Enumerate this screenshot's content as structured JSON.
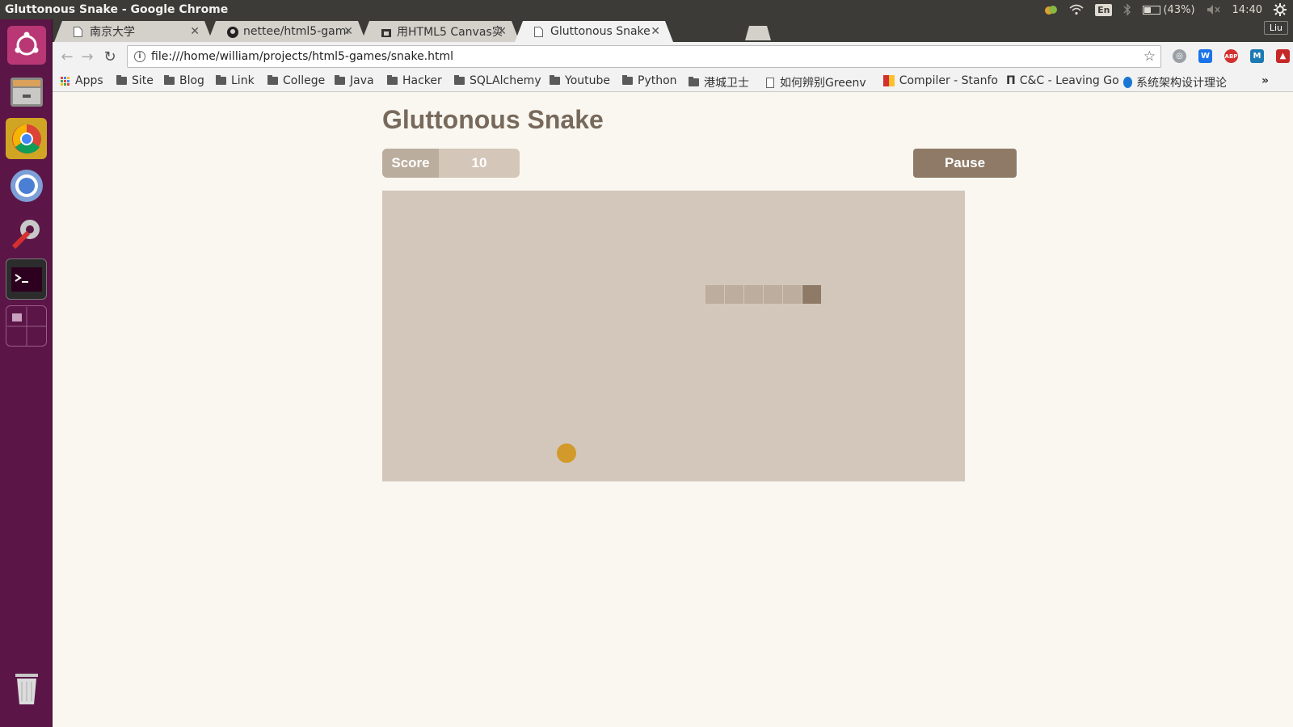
{
  "system": {
    "window_title": "Gluttonous Snake - Google Chrome",
    "battery": "(43%)",
    "time": "14:40",
    "input_method": "En",
    "user": "Liu"
  },
  "browser": {
    "tabs": [
      {
        "title": "南京大学",
        "active": false
      },
      {
        "title": "nettee/html5-game",
        "active": false
      },
      {
        "title": "用HTML5 Canvas实",
        "active": false
      },
      {
        "title": "Gluttonous Snake",
        "active": true
      }
    ],
    "url": "file:///home/william/projects/html5-games/snake.html",
    "bookmarks": [
      {
        "label": "Apps",
        "icon": "apps-grid-icon"
      },
      {
        "label": "Site",
        "icon": "folder-icon"
      },
      {
        "label": "Blog",
        "icon": "folder-icon"
      },
      {
        "label": "Link",
        "icon": "folder-icon"
      },
      {
        "label": "College",
        "icon": "folder-icon"
      },
      {
        "label": "Java",
        "icon": "folder-icon"
      },
      {
        "label": "Hacker",
        "icon": "folder-icon"
      },
      {
        "label": "SQLAlchemy",
        "icon": "folder-icon"
      },
      {
        "label": "Youtube",
        "icon": "folder-icon"
      },
      {
        "label": "Python",
        "icon": "folder-icon"
      },
      {
        "label": "港城卫士",
        "icon": "folder-icon"
      },
      {
        "label": "如何辨别Greenv",
        "icon": "page-icon"
      },
      {
        "label": "Compiler - Stanfo",
        "icon": "site-icon"
      },
      {
        "label": "C&C - Leaving Go",
        "icon": "pi-icon"
      },
      {
        "label": "系统架构设计理论",
        "icon": "site-icon"
      }
    ],
    "overflow": "»"
  },
  "game": {
    "title": "Gluttonous Snake",
    "score_label": "Score",
    "score": "10",
    "pause_label": "Pause",
    "colors": {
      "board": "#d3c7bb",
      "snake_body": "#bcad9e",
      "snake_head": "#8e7a66",
      "food": "#d19a2a"
    }
  }
}
